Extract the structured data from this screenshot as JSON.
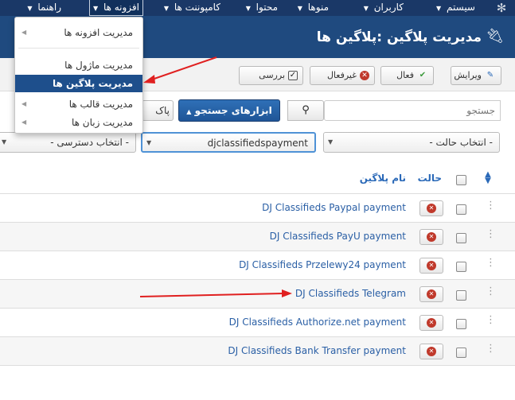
{
  "navbar": {
    "items": [
      {
        "label": "سیستم"
      },
      {
        "label": "کاربران"
      },
      {
        "label": "منوها"
      },
      {
        "label": "محتوا"
      },
      {
        "label": "کامپوننت ها"
      },
      {
        "label": "افزونه ها"
      },
      {
        "label": "راهنما"
      }
    ],
    "active": "افزونه ها"
  },
  "dropdown": {
    "items": [
      {
        "label": "مدیریت افزونه ها"
      },
      {
        "label": "مدیریت ماژول ها"
      },
      {
        "label": "مدیریت پلاگین ها"
      },
      {
        "label": "مدیریت قالب ها"
      },
      {
        "label": "مدیریت زبان ها"
      }
    ],
    "active_index": 2
  },
  "header": {
    "title": "مدیریت پلاگین :پلاگین ها"
  },
  "toolbar": {
    "edit_label": "ویرایش",
    "enable_label": "فعال",
    "disable_label": "غیرفعال",
    "checkin_label": "بررسی"
  },
  "search": {
    "placeholder": "جستجو",
    "tools_label": "ابزارهای جستجو",
    "clear_label": "پاک"
  },
  "filters": {
    "state": "- انتخاب حالت -",
    "folder": "djclassifiedspayment",
    "access": "- انتخاب دسترسی -"
  },
  "table": {
    "col_status": "حالت",
    "col_name": "نام پلاگین",
    "rows": [
      {
        "name": "DJ Classifieds Paypal payment"
      },
      {
        "name": "DJ Classifieds PayU payment"
      },
      {
        "name": "DJ Classifieds Przelewy24 payment"
      },
      {
        "name": "DJ Classifieds Telegram"
      },
      {
        "name": "DJ Classifieds Authorize.net payment"
      },
      {
        "name": "DJ Classifieds Bank Transfer payment"
      }
    ]
  },
  "colors": {
    "navbar": "#1a3867",
    "header": "#1f4a7f",
    "primary_button": "#2a69b8",
    "link": "#2a5fa5",
    "annotation_arrow": "#e02020",
    "status_disabled": "#c0392b"
  }
}
